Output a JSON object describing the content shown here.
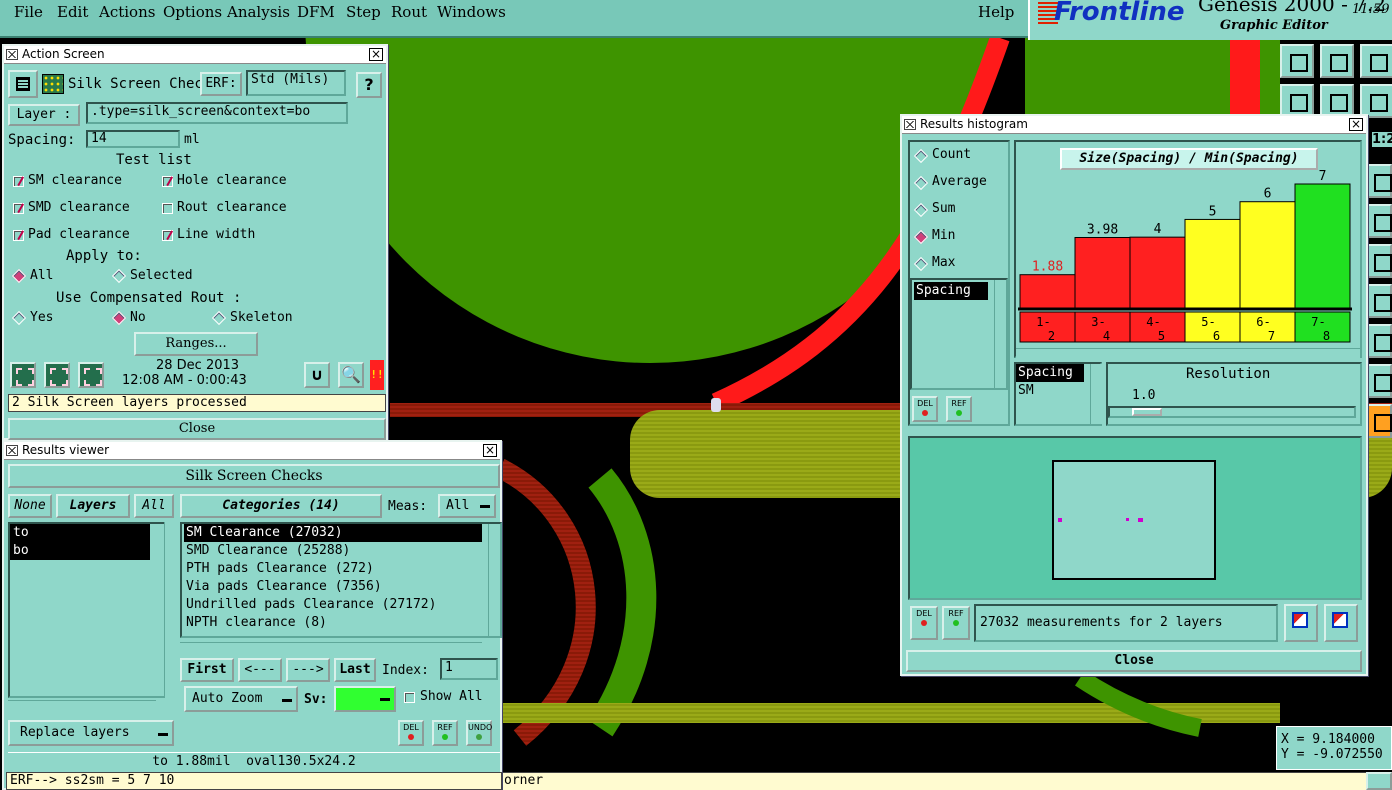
{
  "menu": {
    "items": [
      "File",
      "Edit",
      "Actions",
      "Options",
      "Analysis",
      "DFM",
      "Step",
      "Rout",
      "Windows"
    ],
    "help": "Help"
  },
  "logo": {
    "brand": "Frontline",
    "app": "Genesis 2000 - 7.2",
    "subtitle": "Graphic Editor",
    "clock": "11:59"
  },
  "action_screen": {
    "title": "Action Screen",
    "name": "Silk Screen Checks",
    "erf_label": "ERF:",
    "erf_value": "Std (Mils)",
    "help_label": "?",
    "layer_label": "Layer :",
    "layer_value": ".type=silk_screen&context=bo",
    "spacing_label": "Spacing:",
    "spacing_value": "14",
    "spacing_unit": "ml",
    "test_list_label": "Test list",
    "tests": [
      {
        "label": "SM clearance",
        "checked": true
      },
      {
        "label": "Hole clearance",
        "checked": true
      },
      {
        "label": "SMD clearance",
        "checked": true
      },
      {
        "label": "Rout clearance",
        "checked": false
      },
      {
        "label": "Pad clearance",
        "checked": true
      },
      {
        "label": "Line width",
        "checked": true
      }
    ],
    "apply_to_label": "Apply to:",
    "apply_all": "All",
    "apply_selected": "Selected",
    "comp_rout_label": "Use Compensated Rout :",
    "comp_yes": "Yes",
    "comp_no": "No",
    "comp_skeleton": "Skeleton",
    "ranges_label": "Ranges...",
    "date": "28 Dec 2013",
    "time": "12:08 AM - 0:00:43",
    "status": "2 Silk Screen layers processed",
    "close_label": "Close",
    "alert_label": "!!"
  },
  "results_viewer": {
    "title": "Results viewer",
    "header": "Silk Screen Checks",
    "none_label": "None",
    "layers_label": "Layers",
    "all_label": "All",
    "categories_label": "Categories (14)",
    "meas_label": "Meas:",
    "meas_value": "All",
    "layers": [
      "to",
      "bo"
    ],
    "categories": [
      "SM Clearance (27032)",
      "SMD Clearance (25288)",
      "PTH pads Clearance (272)",
      "Via pads Clearance (7356)",
      "Undrilled pads Clearance (27172)",
      "NPTH clearance (8)"
    ],
    "first_label": "First",
    "prev_label": "<---",
    "next_label": "--->",
    "last_label": "Last",
    "index_label": "Index:",
    "index_value": "1",
    "zoom_label": "Auto Zoom",
    "sv_label": "Sv:",
    "show_all_label": "Show All",
    "replace_label": "Replace layers",
    "del_label": "DEL",
    "ref_label": "REF",
    "undo_label": "UNDO",
    "measurement": "to 1.88mil  oval130.5x24.2",
    "erf_line": "ERF--> ss2sm = 5 7 10"
  },
  "histogram": {
    "title": "Results histogram",
    "modes": [
      {
        "label": "Count",
        "on": false
      },
      {
        "label": "Average",
        "on": false
      },
      {
        "label": "Sum",
        "on": false
      },
      {
        "label": "Min",
        "on": true
      },
      {
        "label": "Max",
        "on": false
      }
    ],
    "list_item": "Spacing",
    "chart_title": "Size(Spacing) / Min(Spacing)",
    "legend_items": [
      "Spacing",
      "SM"
    ],
    "resolution_label": "Resolution",
    "resolution_value": "1.0",
    "del_label": "DEL",
    "ref_label": "REF",
    "summary": "27032 measurements for 2 layers",
    "close_label": "Close"
  },
  "chart_data": {
    "type": "bar",
    "title": "Size(Spacing) / Min(Spacing)",
    "categories": [
      "1-\n2",
      "3-\n4",
      "4-\n5",
      "5-\n6",
      "6-\n7",
      "7-\n8"
    ],
    "values": [
      1.88,
      3.98,
      4,
      5,
      6,
      7
    ],
    "value_labels": [
      "1.88",
      "3.98",
      "4",
      "5",
      "6",
      "7"
    ],
    "colors": [
      "#ff2020",
      "#ff2020",
      "#ff2020",
      "#ffff20",
      "#ffff20",
      "#20e020"
    ],
    "ylim": [
      0,
      7
    ]
  },
  "coords": {
    "x_label": "X = 9.184000",
    "y_label": "Y = -9.072550"
  },
  "bottom_status": "orner",
  "right_toolbar": {
    "scale": "1:2"
  },
  "colors": {
    "panel": "#8fd7c9",
    "board_green": "#3e9400",
    "trace_red": "#ff1a1a",
    "pad_olive": "#8c9c10"
  }
}
